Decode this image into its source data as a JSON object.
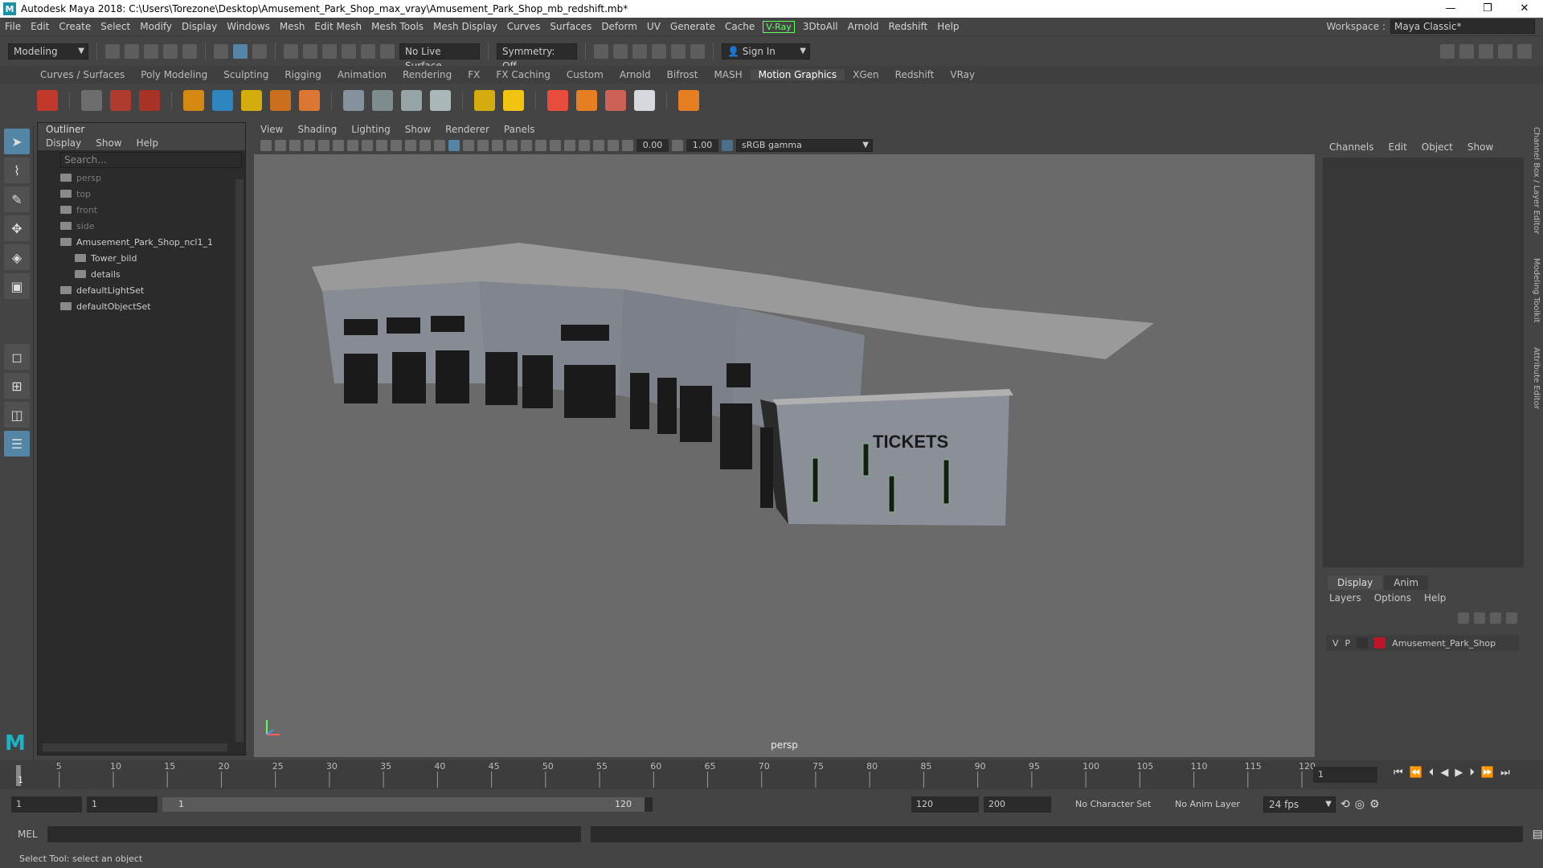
{
  "window": {
    "title": "Autodesk Maya 2018: C:\\Users\\Torezone\\Desktop\\Amusement_Park_Shop_max_vray\\Amusement_Park_Shop_mb_redshift.mb*",
    "minimize": "—",
    "maximize": "❐",
    "close": "✕"
  },
  "menubar": {
    "items": [
      "File",
      "Edit",
      "Create",
      "Select",
      "Modify",
      "Display",
      "Windows",
      "Mesh",
      "Edit Mesh",
      "Mesh Tools",
      "Mesh Display",
      "Curves",
      "Surfaces",
      "Deform",
      "UV",
      "Generate",
      "Cache"
    ],
    "vray": "V-Ray",
    "items2": [
      "3DtoAll",
      "Arnold",
      "Redshift",
      "Help"
    ],
    "workspace_label": "Workspace :",
    "workspace_value": "Maya Classic*"
  },
  "statusline": {
    "mode": "Modeling",
    "live_surface": "No Live Surface",
    "symmetry": "Symmetry: Off",
    "sign_in": "Sign In"
  },
  "shelf": {
    "tabs": [
      "Curves / Surfaces",
      "Poly Modeling",
      "Sculpting",
      "Rigging",
      "Animation",
      "Rendering",
      "FX",
      "FX Caching",
      "Custom",
      "Arnold",
      "Bifrost",
      "MASH",
      "Motion Graphics",
      "XGen",
      "Redshift",
      "VRay"
    ],
    "active_tab": "Motion Graphics"
  },
  "outliner": {
    "title": "Outliner",
    "menu": [
      "Display",
      "Show",
      "Help"
    ],
    "search_placeholder": "Search...",
    "items": [
      {
        "label": "persp",
        "dim": true,
        "indent": 0
      },
      {
        "label": "top",
        "dim": true,
        "indent": 0
      },
      {
        "label": "front",
        "dim": true,
        "indent": 0
      },
      {
        "label": "side",
        "dim": true,
        "indent": 0
      },
      {
        "label": "Amusement_Park_Shop_ncl1_1",
        "dim": false,
        "indent": 0
      },
      {
        "label": "Tower_bild",
        "dim": false,
        "indent": 1
      },
      {
        "label": "details",
        "dim": false,
        "indent": 1
      },
      {
        "label": "defaultLightSet",
        "dim": false,
        "indent": 0
      },
      {
        "label": "defaultObjectSet",
        "dim": false,
        "indent": 0
      }
    ]
  },
  "viewport": {
    "menu": [
      "View",
      "Shading",
      "Lighting",
      "Show",
      "Renderer",
      "Panels"
    ],
    "field1": "0.00",
    "field2": "1.00",
    "color_space": "sRGB gamma",
    "camera_label": "persp",
    "sign_text": "TICKETS"
  },
  "channelbox": {
    "menu": [
      "Channels",
      "Edit",
      "Object",
      "Show"
    ]
  },
  "layers": {
    "tabs": [
      "Display",
      "Anim"
    ],
    "menu": [
      "Layers",
      "Options",
      "Help"
    ],
    "row": {
      "v": "V",
      "p": "P",
      "name": "Amusement_Park_Shop",
      "color": "#c0142a"
    }
  },
  "side_tabs": [
    "Channel Box / Layer Editor",
    "Modeling Toolkit",
    "Attribute Editor"
  ],
  "timeline": {
    "ticks": [
      5,
      10,
      15,
      20,
      25,
      30,
      35,
      40,
      45,
      50,
      55,
      60,
      65,
      70,
      75,
      80,
      85,
      90,
      95,
      100,
      105,
      110,
      115,
      120
    ],
    "current_marker": "1",
    "current_frame": "1"
  },
  "range": {
    "start": "1",
    "anim_start": "1",
    "slider_start": "1",
    "slider_end": "120",
    "end": "120",
    "anim_end": "200",
    "character_set": "No Character Set",
    "anim_layer": "No Anim Layer",
    "fps": "24 fps"
  },
  "commandline": {
    "label": "MEL"
  },
  "helpline": {
    "text": "Select Tool: select an object"
  }
}
